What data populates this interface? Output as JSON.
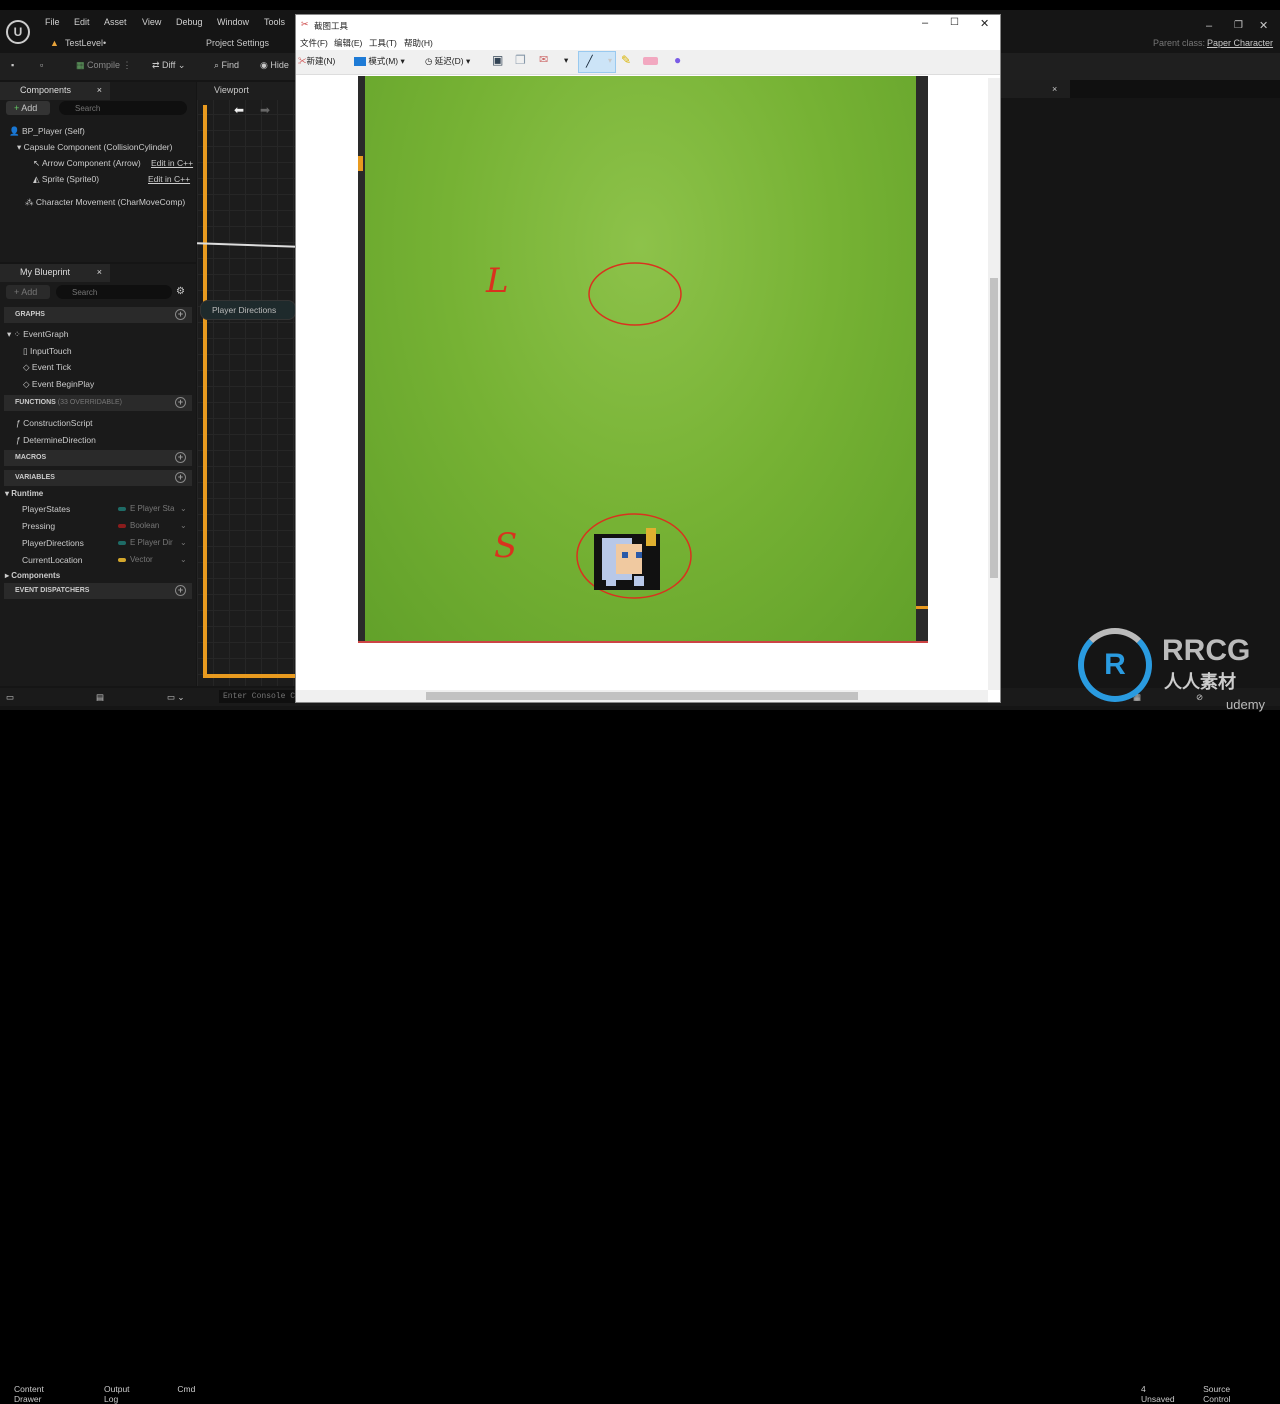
{
  "ue": {
    "menu": [
      "File",
      "Edit",
      "Asset",
      "View",
      "Debug",
      "Window",
      "Tools"
    ],
    "level": "TestLevel•",
    "project_settings": "Project Settings",
    "toolbar": {
      "compile": "Compile",
      "diff": "Diff",
      "find": "Find",
      "hide": "Hide"
    },
    "parent_class_label": "Parent class:",
    "parent_class": "Paper Character",
    "components": {
      "tab": "Components",
      "add": "Add",
      "search_placeholder": "Search",
      "items": [
        {
          "label": "BP_Player (Self)"
        },
        {
          "label": "Capsule Component (CollisionCylinder)"
        },
        {
          "label": "Arrow Component (Arrow)",
          "link": "Edit in C++"
        },
        {
          "label": "Sprite (Sprite0)",
          "link": "Edit in C++"
        },
        {
          "label": "Character Movement (CharMoveComp)"
        }
      ]
    },
    "viewport_tab": "Viewport",
    "graph_node": "Player Directions",
    "my_blueprint": {
      "tab": "My Blueprint",
      "add": "Add",
      "search_placeholder": "Search",
      "graphs": "GRAPHS",
      "graph_items": [
        "EventGraph",
        "InputTouch",
        "Event Tick",
        "Event BeginPlay"
      ],
      "functions": "FUNCTIONS",
      "functions_note": "(33 OVERRIDABLE)",
      "function_items": [
        "ConstructionScript",
        "DetermineDirection"
      ],
      "macros": "MACROS",
      "variables": "VARIABLES",
      "runtime": "Runtime",
      "vars": [
        {
          "name": "PlayerStates",
          "type": "E Player Sta",
          "color": "#1e6b66"
        },
        {
          "name": "Pressing",
          "type": "Boolean",
          "color": "#8a1c1c"
        },
        {
          "name": "PlayerDirections",
          "type": "E Player Dir",
          "color": "#1e6b66"
        },
        {
          "name": "CurrentLocation",
          "type": "Vector",
          "color": "#d4a72c"
        }
      ],
      "components": "Components",
      "dispatchers": "EVENT DISPATCHERS"
    },
    "status": {
      "content_drawer": "Content Drawer",
      "output_log": "Output Log",
      "cmd": "Cmd",
      "console_placeholder": "Enter Console C",
      "unsaved": "4 Unsaved",
      "source_control": "Source Control"
    }
  },
  "snip": {
    "title": "截图工具",
    "menu": [
      "文件(F)",
      "编辑(E)",
      "工具(T)",
      "帮助(H)"
    ],
    "new": "新建(N)",
    "mode": "模式(M)",
    "delay": "延迟(D)",
    "annotations": [
      "L",
      "S"
    ]
  },
  "watermark": {
    "brand": "RRCG",
    "sub": "人人素材",
    "udemy": "udemy"
  }
}
